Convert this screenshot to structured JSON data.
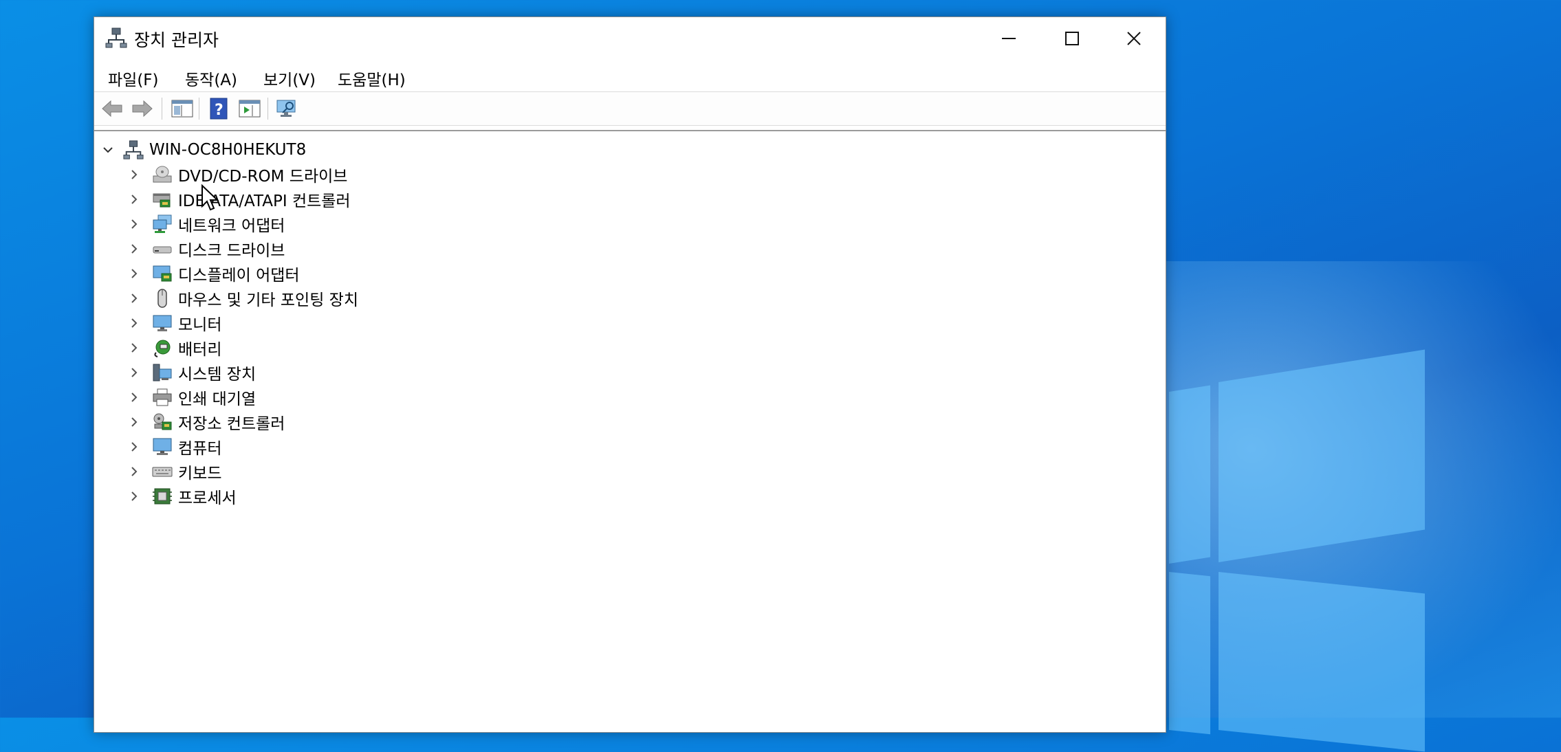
{
  "window": {
    "title": "장치 관리자",
    "icon": "device-manager-icon"
  },
  "menu": [
    {
      "label": "파일(F)"
    },
    {
      "label": "동작(A)"
    },
    {
      "label": "보기(V)"
    },
    {
      "label": "도움말(H)"
    }
  ],
  "toolbar": {
    "buttons": [
      "back-arrow-icon",
      "forward-arrow-icon",
      "show-hide-console-tree-icon",
      "help-icon",
      "action-pane-icon",
      "scan-hardware-icon"
    ]
  },
  "tree": {
    "root": {
      "label": "WIN-OC8H0HEKUT8",
      "icon": "computer-network-icon",
      "expanded": true
    },
    "items": [
      {
        "label": "DVD/CD-ROM 드라이브",
        "icon": "dvd-drive-icon"
      },
      {
        "label": "IDE ATA/ATAPI 컨트롤러",
        "icon": "ide-controller-icon"
      },
      {
        "label": "네트워크 어댑터",
        "icon": "network-adapter-icon"
      },
      {
        "label": "디스크 드라이브",
        "icon": "disk-drive-icon"
      },
      {
        "label": "디스플레이 어댑터",
        "icon": "display-adapter-icon"
      },
      {
        "label": "마우스 및 기타 포인팅 장치",
        "icon": "mouse-icon"
      },
      {
        "label": "모니터",
        "icon": "monitor-icon"
      },
      {
        "label": "배터리",
        "icon": "battery-icon"
      },
      {
        "label": "시스템 장치",
        "icon": "system-device-icon"
      },
      {
        "label": "인쇄 대기열",
        "icon": "printer-icon"
      },
      {
        "label": "저장소 컨트롤러",
        "icon": "storage-controller-icon"
      },
      {
        "label": "컴퓨터",
        "icon": "computer-icon"
      },
      {
        "label": "키보드",
        "icon": "keyboard-icon"
      },
      {
        "label": "프로세서",
        "icon": "processor-icon"
      }
    ]
  }
}
